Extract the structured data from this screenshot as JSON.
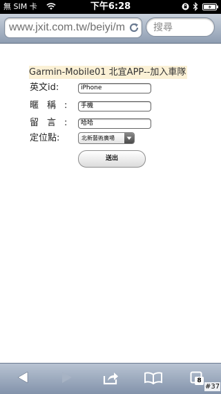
{
  "status_bar": {
    "carrier": "無 SIM 卡",
    "time": "下午6:28"
  },
  "browser": {
    "url": "www.jxit.com.tw/beiyi/m",
    "search_placeholder": "搜尋",
    "tab_count": "8"
  },
  "form": {
    "title": "Garmin-Mobile01 北宜APP--加入車隊",
    "english_id_label": "英文id:",
    "english_id_value": "iPhone",
    "nickname_label": "暱稱:",
    "nickname_value": "手機",
    "message_label": "留言:",
    "message_value": "哈哈",
    "location_label": "定位點:",
    "location_selected": "北新藝術廣場",
    "submit_label": "送出"
  },
  "watermark": "#37"
}
